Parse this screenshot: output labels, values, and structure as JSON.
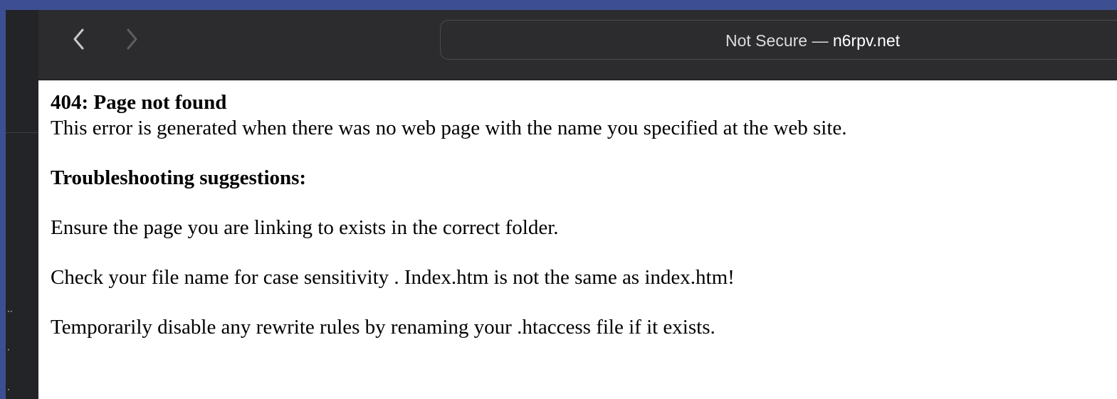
{
  "browser": {
    "address_prefix": "Not Secure —",
    "address_domain": "n6rpv.net"
  },
  "page": {
    "title": "404: Page not found",
    "description": "This error is generated when there was no web page with the name you specified at the web site.",
    "troubleshooting_heading": "Troubleshooting suggestions:",
    "suggestions": [
      "Ensure the page you are linking to exists in the correct folder.",
      "Check your file name for case sensitivity . Index.htm is not the same as index.htm!",
      "Temporarily disable any rewrite rules by renaming your .htaccess file if it exists."
    ]
  },
  "colors": {
    "toolbar_bg": "#2c2c2e",
    "desktop_bg": "#3d4f92",
    "page_bg": "#ffffff"
  },
  "icons": {
    "back": "chevron-left-icon",
    "forward": "chevron-right-icon"
  }
}
